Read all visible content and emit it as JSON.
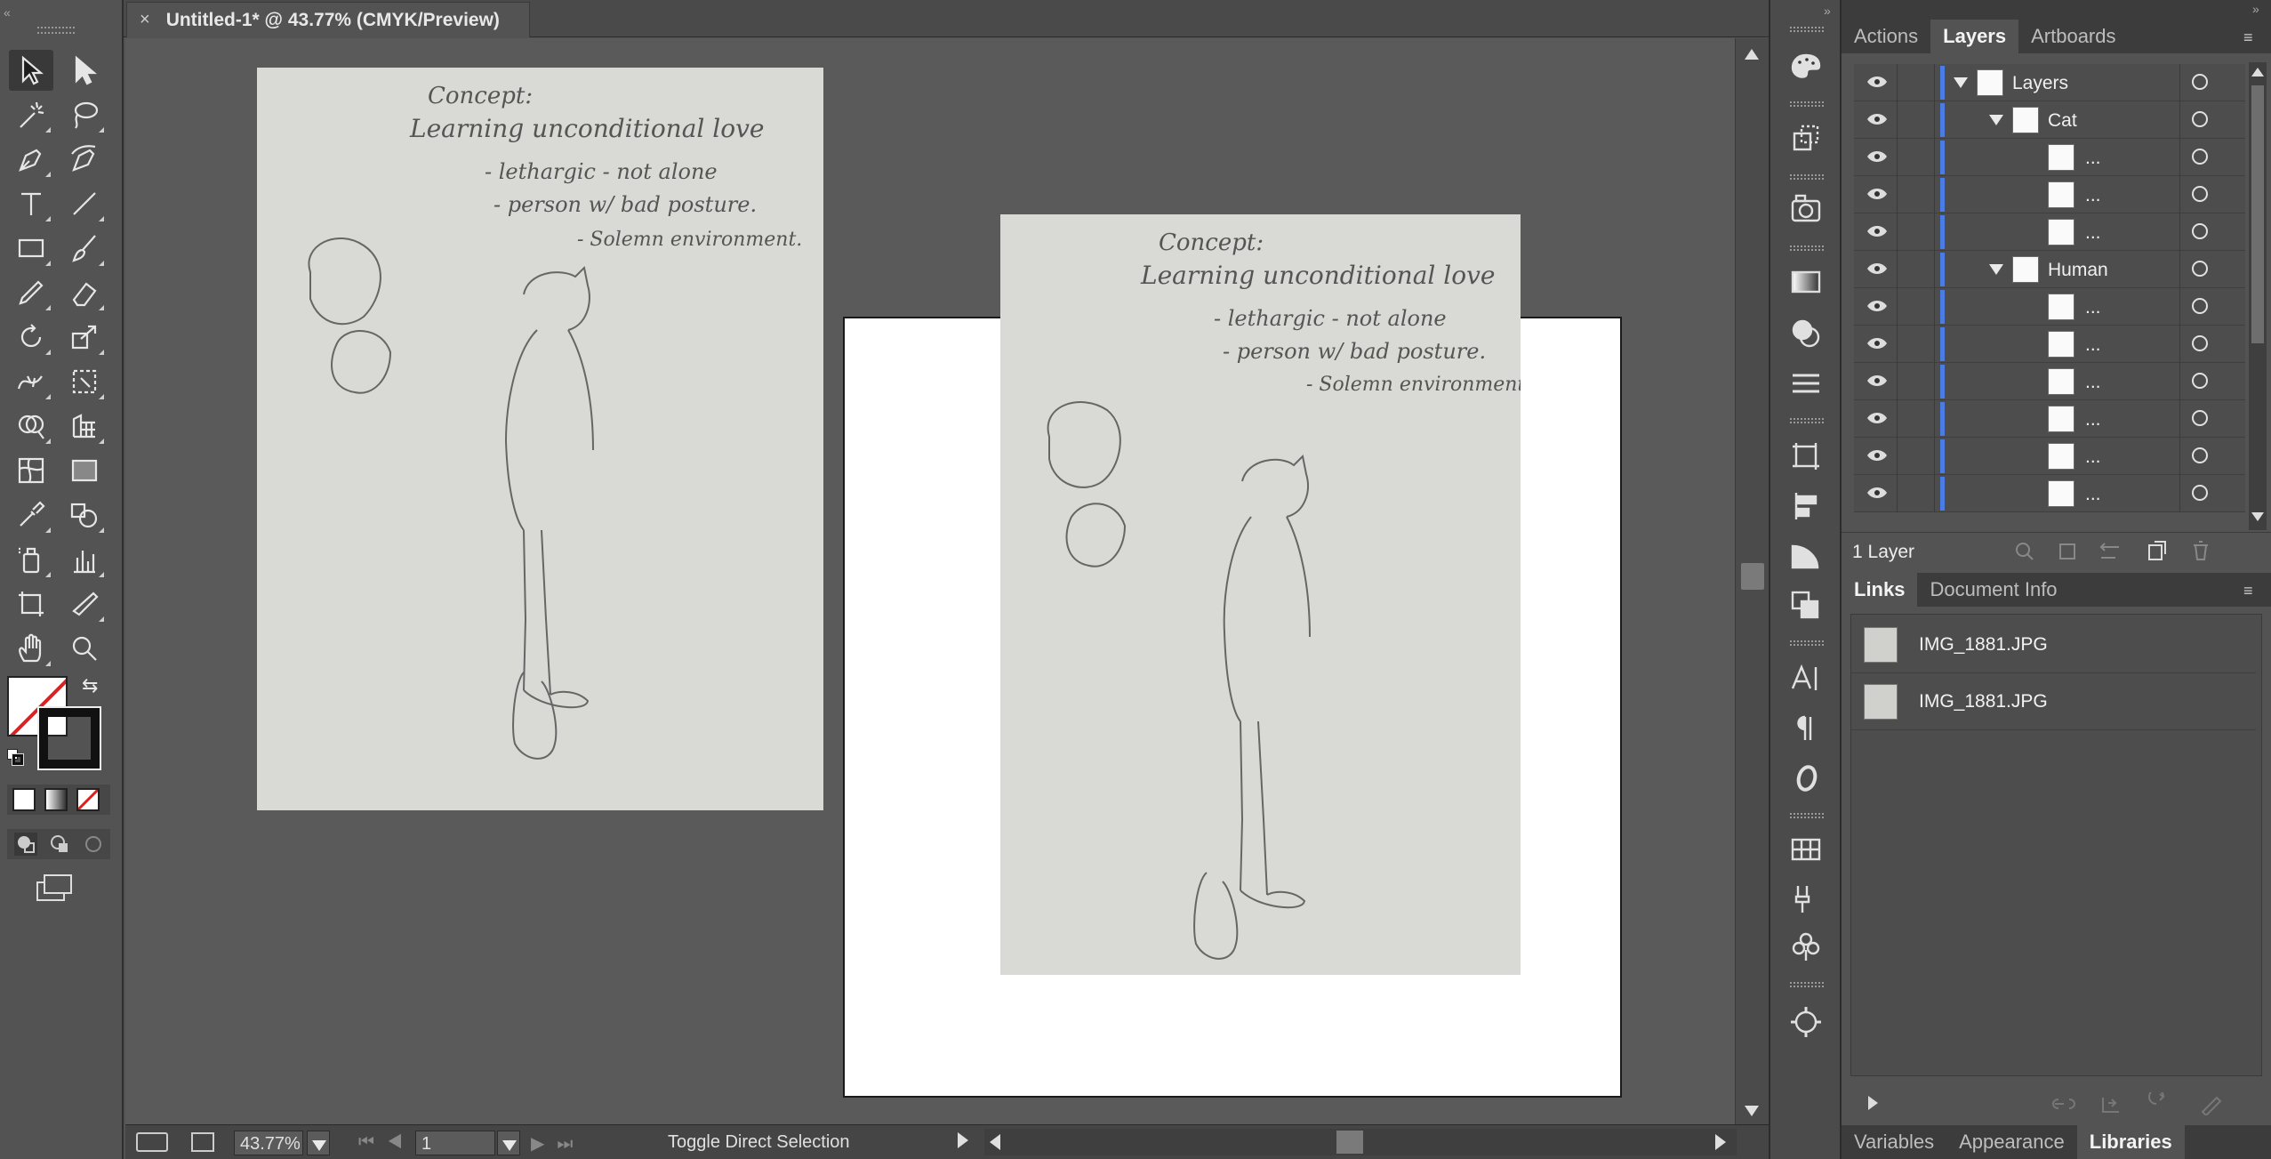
{
  "document": {
    "tab_title": "Untitled-1* @ 43.77% (CMYK/Preview)",
    "close_glyph": "×"
  },
  "tools": [
    "selection-tool",
    "direct-selection-tool",
    "magic-wand-tool",
    "lasso-tool",
    "pen-tool",
    "curvature-tool",
    "type-tool",
    "line-segment-tool",
    "rectangle-tool",
    "paintbrush-tool",
    "pencil-tool",
    "eraser-tool",
    "rotate-tool",
    "scale-tool",
    "width-tool",
    "free-transform-tool",
    "shape-builder-tool",
    "perspective-grid-tool",
    "mesh-tool",
    "gradient-tool",
    "eyedropper-tool",
    "blend-tool",
    "symbol-sprayer-tool",
    "column-graph-tool",
    "artboard-tool",
    "slice-tool",
    "hand-tool",
    "zoom-tool"
  ],
  "sketch_text": {
    "concept": "Concept:",
    "line1": "Learning unconditional love",
    "line2": "- lethargic  - not alone",
    "line3": "- person w/ bad posture.",
    "line4": "- Solemn environment."
  },
  "status": {
    "zoom": "43.77%",
    "artboard_number": "1",
    "tool_hint": "Toggle Direct Selection"
  },
  "layers_panel": {
    "tabs": [
      "Actions",
      "Layers",
      "Artboards"
    ],
    "active_tab": "Layers",
    "rows": [
      {
        "label": "Layers",
        "indent": 0,
        "expanded": true
      },
      {
        "label": "Cat",
        "indent": 1,
        "expanded": true
      },
      {
        "label": "...",
        "indent": 2
      },
      {
        "label": "...",
        "indent": 2
      },
      {
        "label": "...",
        "indent": 2
      },
      {
        "label": "Human",
        "indent": 1,
        "expanded": true
      },
      {
        "label": "...",
        "indent": 2
      },
      {
        "label": "...",
        "indent": 2
      },
      {
        "label": "...",
        "indent": 2
      },
      {
        "label": "...",
        "indent": 2
      },
      {
        "label": "...",
        "indent": 2
      },
      {
        "label": "...",
        "indent": 2
      }
    ],
    "footer_count": "1 Layer"
  },
  "links_panel": {
    "tabs": [
      "Links",
      "Document Info"
    ],
    "active_tab": "Links",
    "files": [
      "IMG_1881.JPG",
      "IMG_1881.JPG"
    ]
  },
  "bottom_tabs": [
    "Variables",
    "Appearance",
    "Libraries"
  ],
  "bottom_active_tab": "Libraries",
  "colors": {
    "ui_background": "#535353",
    "layer_color_bar": "#4a7de4",
    "artboard": "#ffffff",
    "none_stroke_red": "#e02020"
  }
}
